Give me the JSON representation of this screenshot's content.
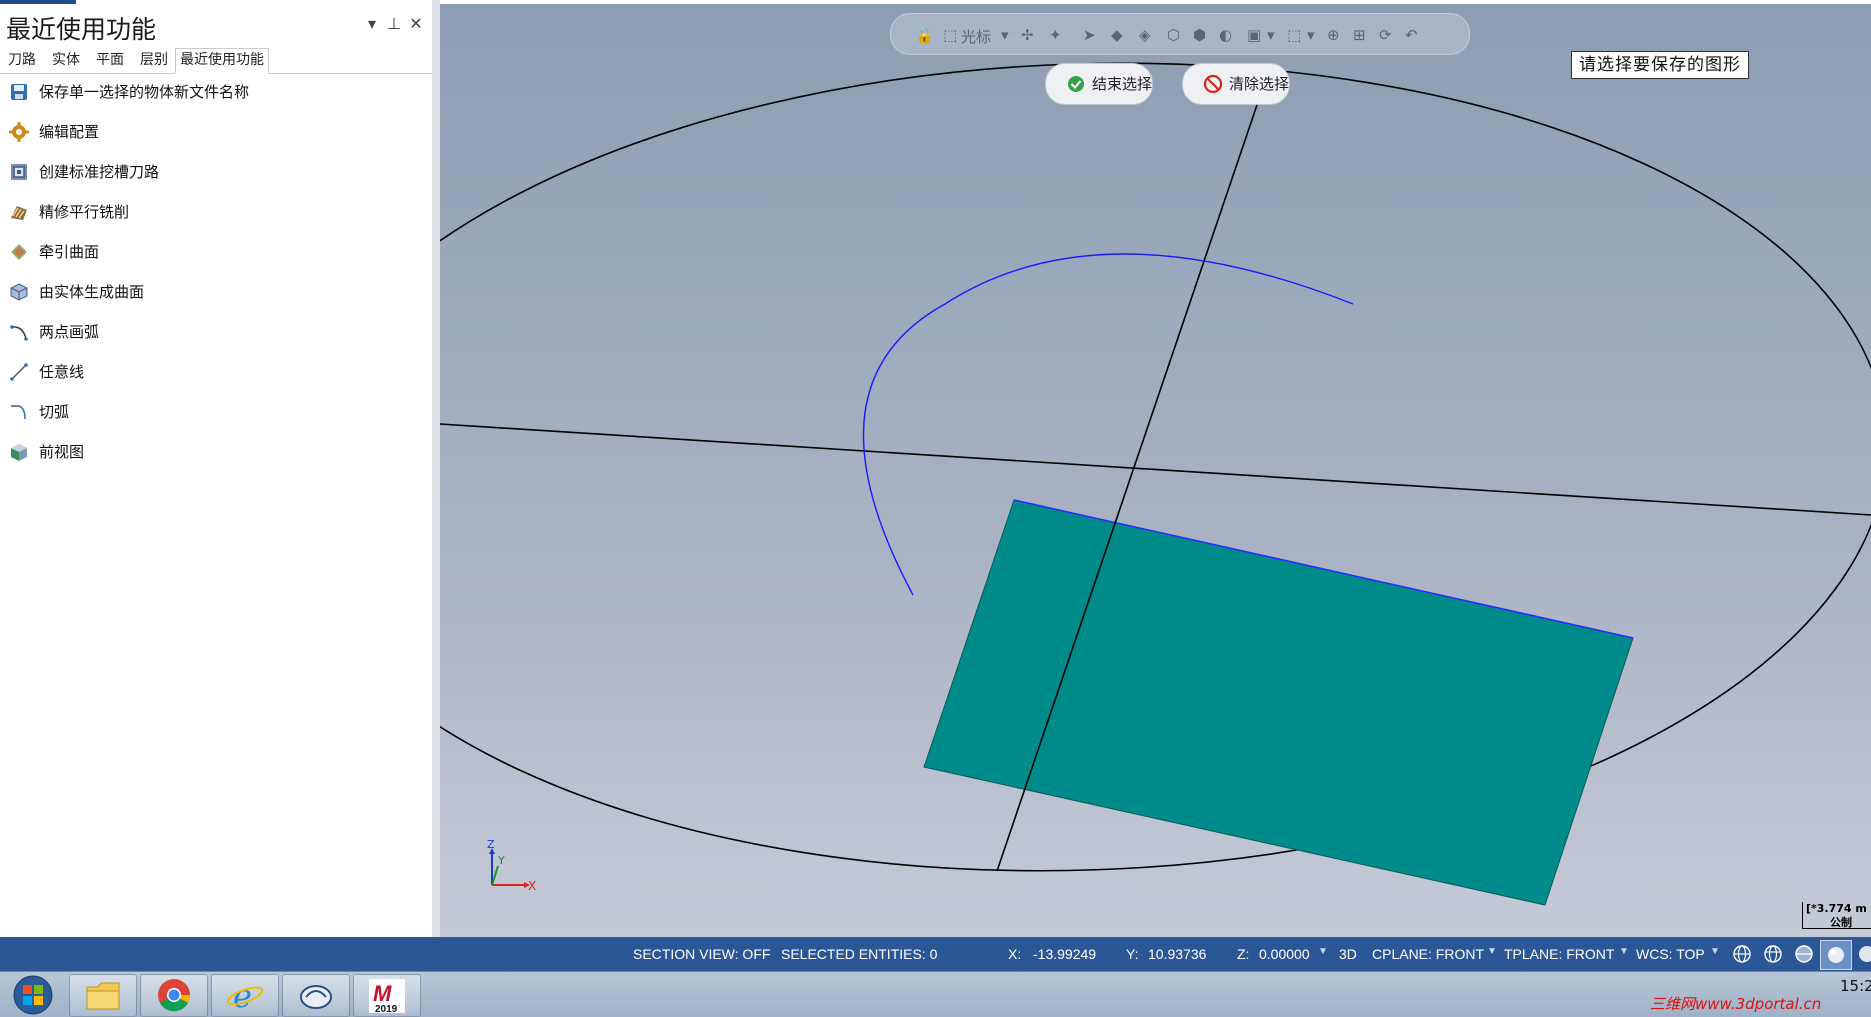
{
  "panel": {
    "title": "最近使用功能",
    "tabs": [
      "刀路",
      "实体",
      "平面",
      "层别",
      "最近使用功能"
    ],
    "items": [
      {
        "label": "保存单一选择的物体新文件名称",
        "icon": "save-icon"
      },
      {
        "label": "编辑配置",
        "icon": "gear-icon"
      },
      {
        "label": "创建标准挖槽刀路",
        "icon": "pocket-toolpath-icon"
      },
      {
        "label": "精修平行铣削",
        "icon": "parallel-milling-icon"
      },
      {
        "label": "牵引曲面",
        "icon": "draft-surface-icon"
      },
      {
        "label": "由实体生成曲面",
        "icon": "surface-from-solid-icon"
      },
      {
        "label": "两点画弧",
        "icon": "arc-two-points-icon"
      },
      {
        "label": "任意线",
        "icon": "line-icon"
      },
      {
        "label": "切弧",
        "icon": "tangent-arc-icon"
      },
      {
        "label": "前视图",
        "icon": "front-view-icon"
      }
    ]
  },
  "viewport": {
    "quick_mask_label": "光标",
    "end_selection": "结束选择",
    "clear_selection": "清除选择",
    "prompt": "请选择要保存的图形",
    "axis_labels": {
      "x": "X",
      "y": "Y",
      "z": "Z"
    },
    "scale_value": "[*3.774 m",
    "scale_unit": "公制",
    "colors": {
      "surface": "#008b8b",
      "arc": "#1a1aff",
      "lines": "#000000"
    }
  },
  "status": {
    "section_view": "SECTION VIEW: OFF",
    "selected_entities": "SELECTED ENTITIES: 0",
    "x_label": "X:",
    "x_value": "-13.99249",
    "y_label": "Y:",
    "y_value": "10.93736",
    "z_label": "Z:",
    "z_value": "0.00000",
    "mode": "3D",
    "cplane": "CPLANE: FRONT",
    "tplane": "TPLANE: FRONT",
    "wcs": "WCS: TOP"
  },
  "taskbar": {
    "clock": "15:2",
    "watermark": "三维网www.3dportal.cn",
    "mastercam_version": "2019"
  }
}
